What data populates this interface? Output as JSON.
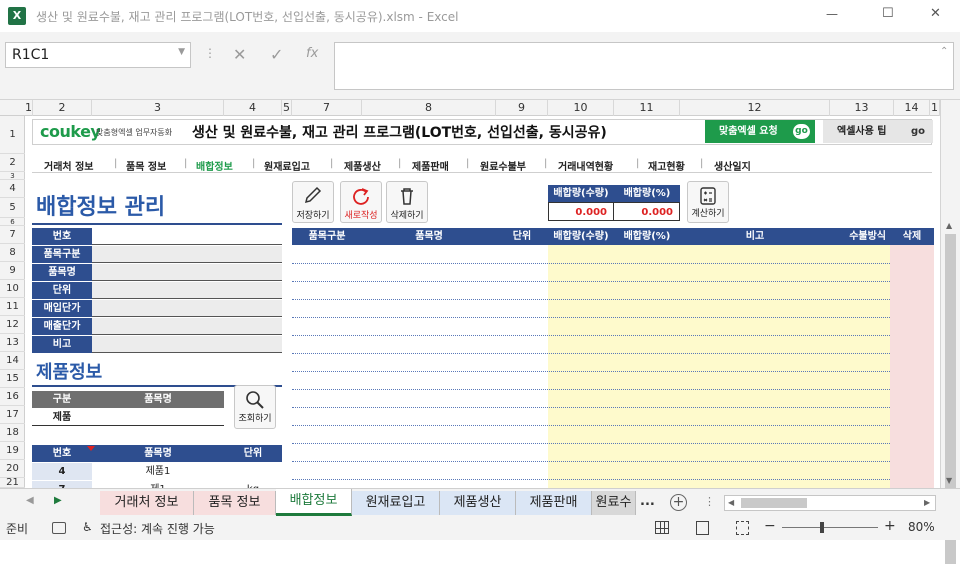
{
  "window": {
    "title": "생산 및 원료수불, 재고 관리 프로그램(LOT번호, 선입선출, 동시공유).xlsm  -  Excel",
    "app_badge": "X",
    "minimize": "—",
    "maximize": "☐",
    "close": "✕"
  },
  "formula_bar": {
    "name_box": "R1C1",
    "cancel": "✕",
    "enter": "✓",
    "fx": "fx",
    "value": ""
  },
  "columns": [
    "1",
    "2",
    "3",
    "4",
    "5",
    "7",
    "8",
    "9",
    "10",
    "11",
    "12",
    "13",
    "14",
    "1"
  ],
  "rows": [
    "1",
    "2",
    "3",
    "4",
    "5",
    "6",
    "7",
    "8",
    "9",
    "10",
    "11",
    "12",
    "13",
    "14",
    "15",
    "16",
    "17",
    "18",
    "19",
    "20",
    "21"
  ],
  "header": {
    "logo": "coukey",
    "slogan": "맞춤형엑셀 업무자동화",
    "title": "생산 및 원료수불, 재고 관리 프로그램(LOT번호, 선입선출, 동시공유)",
    "btn_custom": "맞춤엑셀 요청",
    "btn_tips": "엑셀사용 팁",
    "go": "go"
  },
  "nav": [
    "거래처 정보",
    "품목 정보",
    "배합정보",
    "원재료입고",
    "제품생산",
    "제품판매",
    "원료수불부",
    "거래내역현황",
    "재고현황",
    "생산일지"
  ],
  "page_title": "배합정보 관리",
  "buttons": {
    "save": "저장하기",
    "new": "새로작성",
    "delete": "삭제하기",
    "calc": "계산하기",
    "search": "조회하기"
  },
  "summary": {
    "qty_label": "배합량(수량)",
    "pct_label": "배합량(%)",
    "qty_value": "0.000",
    "pct_value": "0.000"
  },
  "form_fields": [
    "번호",
    "품목구분",
    "품목명",
    "단위",
    "매입단가",
    "매출단가",
    "비고"
  ],
  "product_section": {
    "title": "제품정보",
    "col_type": "구분",
    "col_name": "품목명",
    "type_value": "제품",
    "name_value": ""
  },
  "list_header": {
    "no": "번호",
    "name": "품목명",
    "unit": "단위"
  },
  "list_rows": [
    {
      "no": "4",
      "name": "제품1",
      "unit": ""
    },
    {
      "no": "7",
      "name": "제1",
      "unit": "kg"
    }
  ],
  "table_header": [
    "품목구분",
    "품목명",
    "단위",
    "배합량(수량)",
    "배합량(%)",
    "비고",
    "수불방식",
    "삭제"
  ],
  "sheet_tabs": [
    "거래처 정보",
    "품목 정보",
    "배합정보",
    "원재료입고",
    "제품생산",
    "제품판매",
    "원료수"
  ],
  "status": {
    "ready": "준비",
    "accessibility": "접근성: 계속 진행 가능",
    "zoom": "80%",
    "more": "..."
  },
  "colors": {
    "excel_green": "#217346",
    "header_blue": "#2e4e8f",
    "title_blue": "#2b5aa8",
    "yellow": "#fefacc",
    "pink": "#f7dede",
    "accent_green": "#1e9b4b"
  }
}
